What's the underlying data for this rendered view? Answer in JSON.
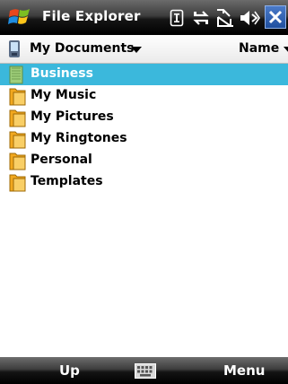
{
  "titlebar": {
    "title": "File Explorer",
    "icons": [
      "windows-flag-icon",
      "sim-icon",
      "sync-icon",
      "signal-off-icon",
      "volume-mute-icon",
      "close-icon"
    ]
  },
  "toolbar": {
    "location": "My Documents",
    "sort": "Name"
  },
  "files": [
    {
      "name": "Business",
      "selected": true
    },
    {
      "name": "My Music",
      "selected": false
    },
    {
      "name": "My Pictures",
      "selected": false
    },
    {
      "name": "My Ringtones",
      "selected": false
    },
    {
      "name": "Personal",
      "selected": false
    },
    {
      "name": "Templates",
      "selected": false
    }
  ],
  "softkeys": {
    "left": "Up",
    "right": "Menu"
  },
  "colors": {
    "selection": "#3bb8dc",
    "folder": "#f2a81e",
    "bar_dark": "#000000"
  }
}
